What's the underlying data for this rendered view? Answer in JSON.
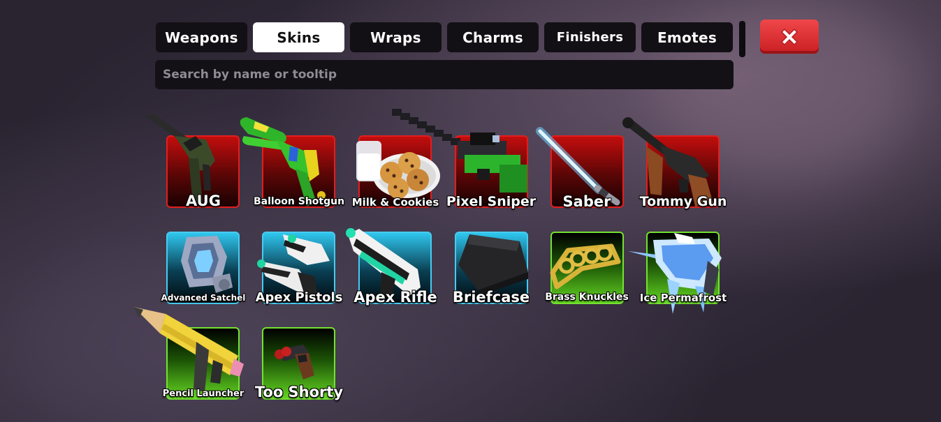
{
  "tabs": [
    {
      "label": "Weapons",
      "active": false
    },
    {
      "label": "Skins",
      "active": true
    },
    {
      "label": "Wraps",
      "active": false
    },
    {
      "label": "Charms",
      "active": false
    },
    {
      "label": "Finishers",
      "active": false
    },
    {
      "label": "Emotes",
      "active": false
    }
  ],
  "search": {
    "placeholder": "Search by name or tooltip",
    "value": ""
  },
  "close_button": {
    "icon": "close-x-icon",
    "color": "#e0383b"
  },
  "rarity_colors": {
    "red": "#e21e1e",
    "blue": "#48cbf0",
    "green": "#74e231"
  },
  "items": [
    {
      "name": "AUG",
      "rarity": "red"
    },
    {
      "name": "Balloon Shotgun",
      "rarity": "red"
    },
    {
      "name": "Milk & Cookies",
      "rarity": "red"
    },
    {
      "name": "Pixel Sniper",
      "rarity": "red"
    },
    {
      "name": "Saber",
      "rarity": "red"
    },
    {
      "name": "Tommy Gun",
      "rarity": "red"
    },
    {
      "name": "Advanced Satchel",
      "rarity": "blue"
    },
    {
      "name": "Apex Pistols",
      "rarity": "blue"
    },
    {
      "name": "Apex Rifle",
      "rarity": "blue"
    },
    {
      "name": "Briefcase",
      "rarity": "blue"
    },
    {
      "name": "Brass Knuckles",
      "rarity": "green"
    },
    {
      "name": "Ice Permafrost",
      "rarity": "green"
    },
    {
      "name": "Pencil Launcher",
      "rarity": "green"
    },
    {
      "name": "Too Shorty",
      "rarity": "green"
    }
  ]
}
